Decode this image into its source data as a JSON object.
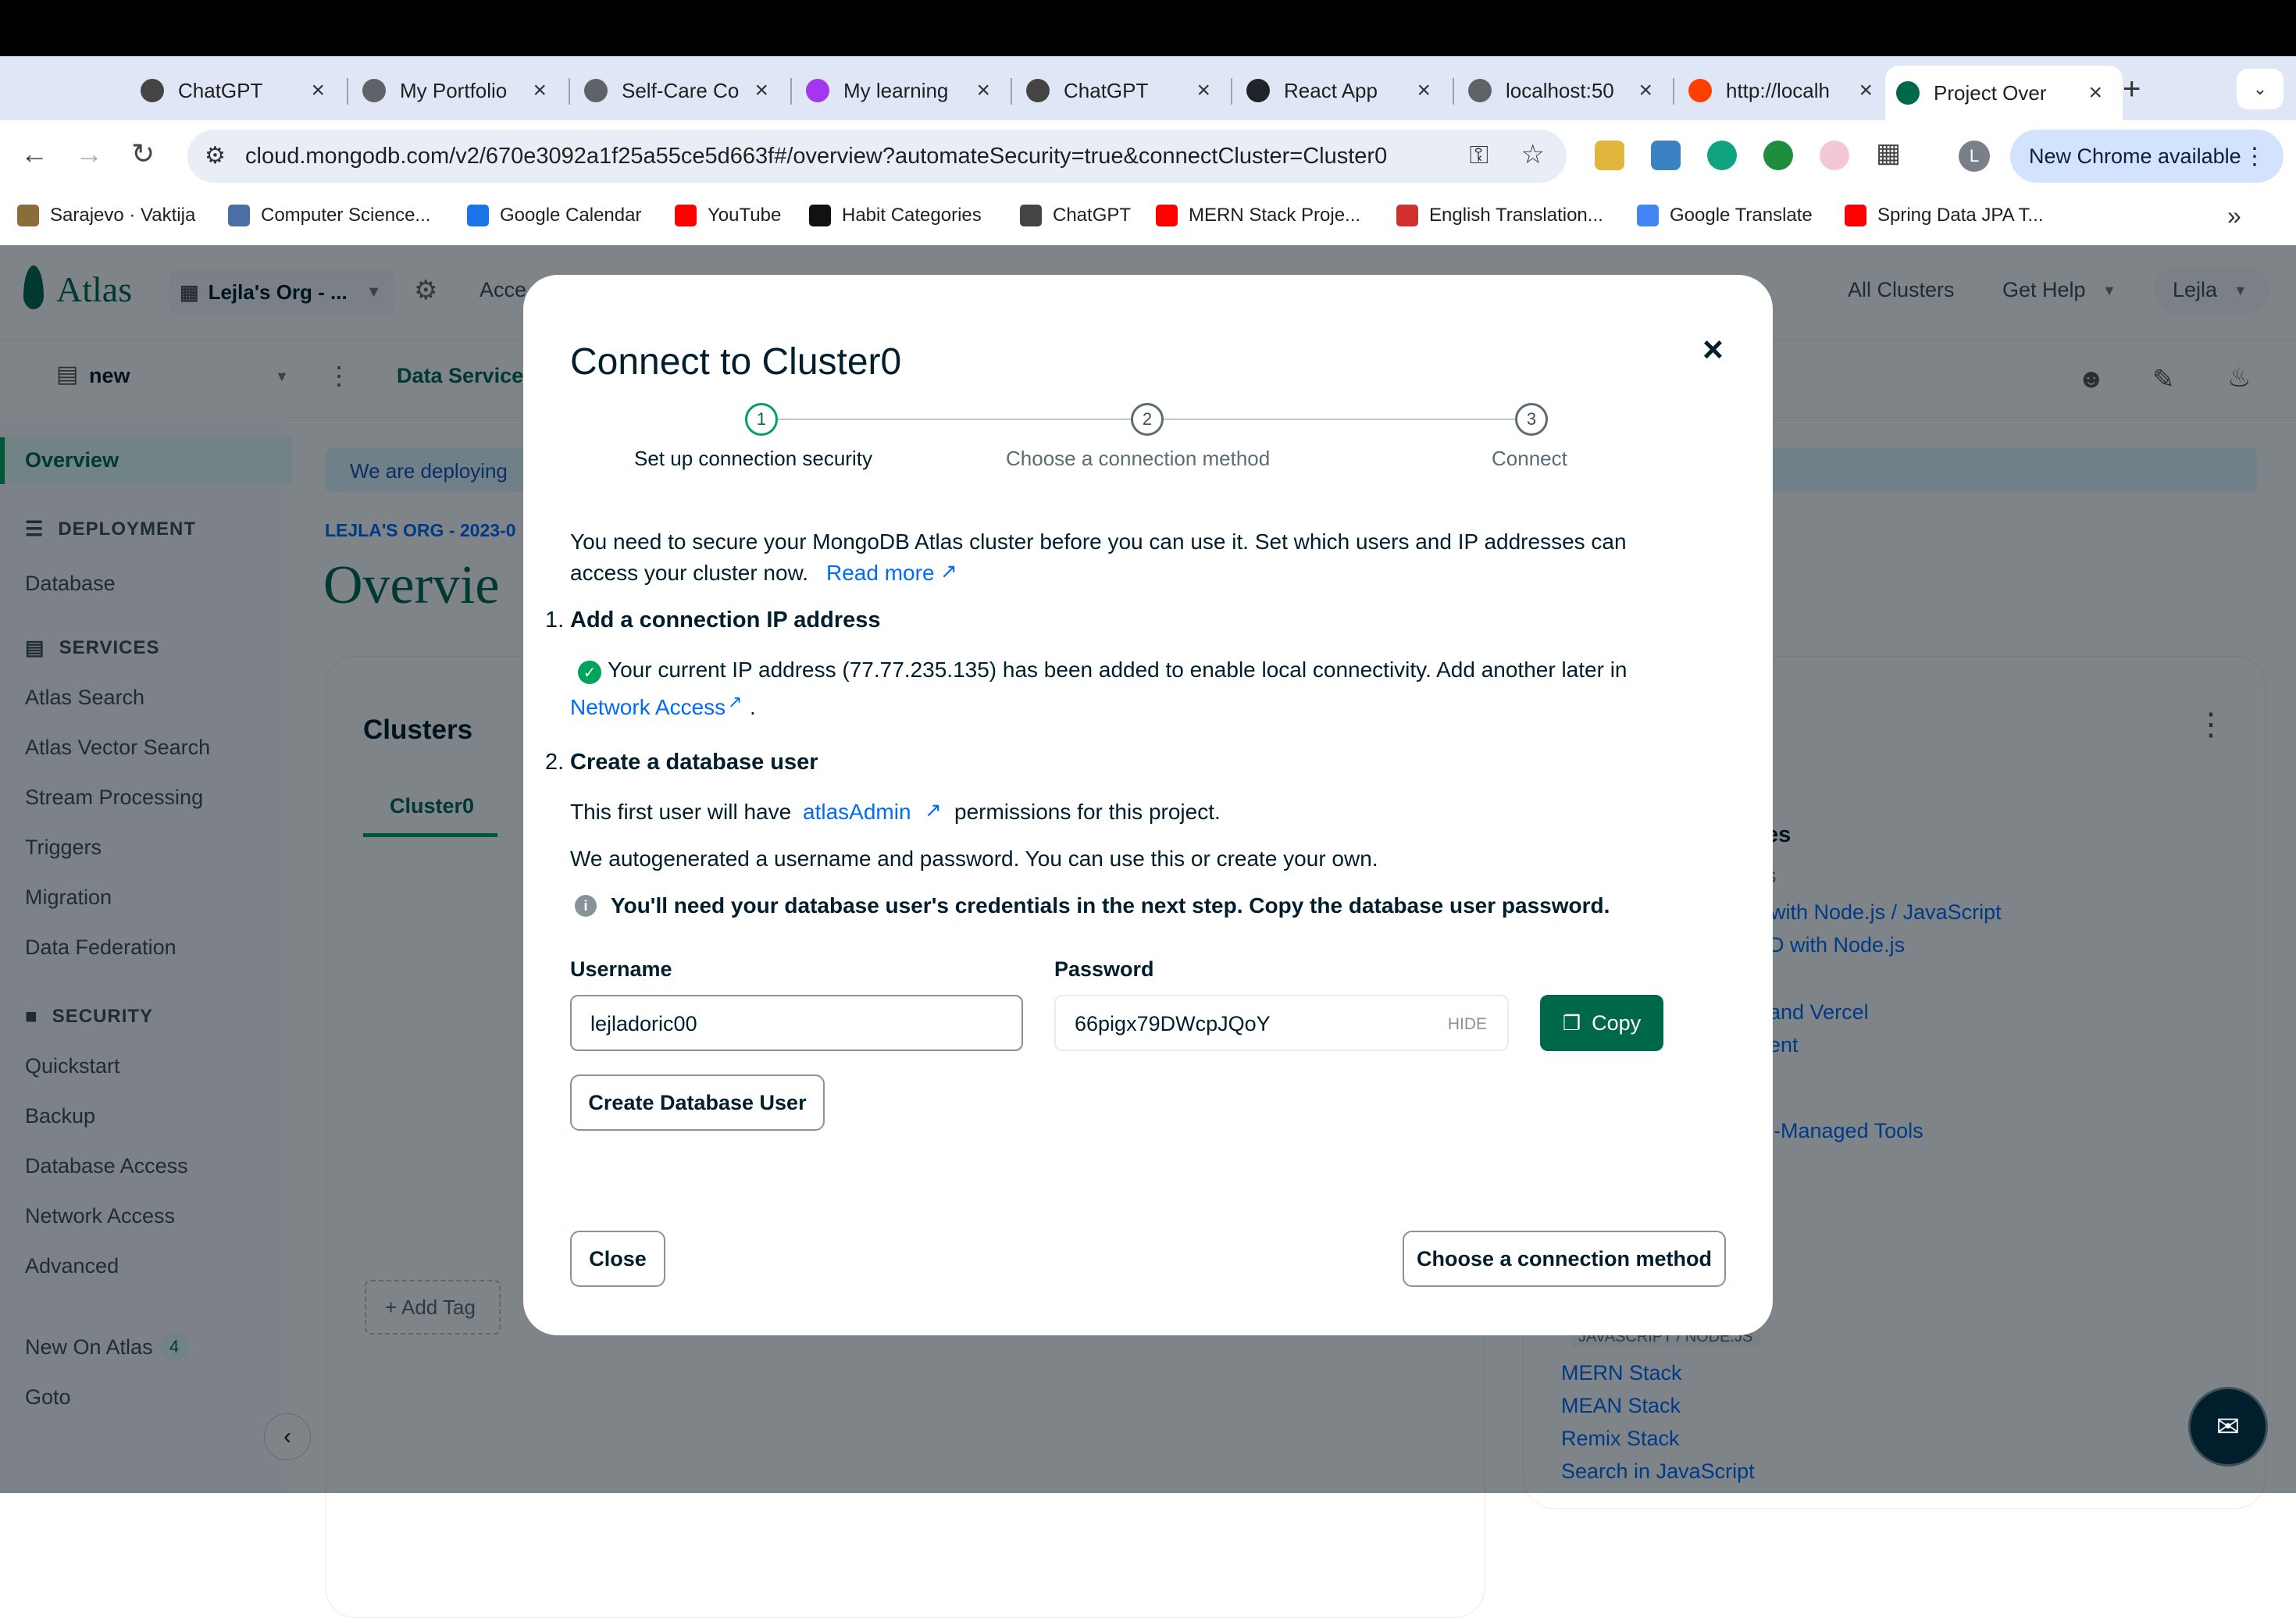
{
  "browser": {
    "tabs": [
      {
        "title": "ChatGPT",
        "icon": "chatgpt-icon",
        "color": "#444444"
      },
      {
        "title": "My Portfolio",
        "icon": "globe-icon",
        "color": "#5f6368"
      },
      {
        "title": "Self-Care Co",
        "icon": "globe-icon",
        "color": "#5f6368"
      },
      {
        "title": "My learning",
        "icon": "learning-icon",
        "color": "#a435f0"
      },
      {
        "title": "ChatGPT",
        "icon": "chatgpt-icon",
        "color": "#444444"
      },
      {
        "title": "React App",
        "icon": "react-icon",
        "color": "#20232a"
      },
      {
        "title": "localhost:50",
        "icon": "globe-icon",
        "color": "#5f6368"
      },
      {
        "title": "http://localh",
        "icon": "svelte-icon",
        "color": "#ff3e00"
      },
      {
        "title": "Project Over",
        "icon": "mongodb-leaf-icon",
        "color": "#00684a",
        "active": true
      }
    ],
    "new_tab": "+",
    "url": "cloud.mongodb.com/v2/670e3092a1f25a55ce5d663f#/overview?automateSecurity=true&connectCluster=Cluster0",
    "profile_initial": "L",
    "new_chrome_label": "New Chrome available",
    "bookmarks": [
      {
        "label": "Sarajevo · Vaktija",
        "icon": "clock-icon",
        "color": "#8a6d3b"
      },
      {
        "label": "Computer Science...",
        "icon": "university-icon",
        "color": "#4a6fa5"
      },
      {
        "label": "Google Calendar",
        "icon": "calendar-icon",
        "color": "#1a73e8"
      },
      {
        "label": "YouTube",
        "icon": "youtube-icon",
        "color": "#ff0000"
      },
      {
        "label": "Habit Categories",
        "icon": "aip-icon",
        "color": "#111111"
      },
      {
        "label": "ChatGPT",
        "icon": "chatgpt-icon",
        "color": "#444444"
      },
      {
        "label": "MERN Stack Proje...",
        "icon": "youtube-icon",
        "color": "#ff0000"
      },
      {
        "label": "English Translation...",
        "icon": "c-icon",
        "color": "#d32f2f"
      },
      {
        "label": "Google Translate",
        "icon": "translate-icon",
        "color": "#4285f4"
      },
      {
        "label": "Spring Data JPA T...",
        "icon": "youtube-icon",
        "color": "#ff0000"
      }
    ],
    "bookmarks_more": "»"
  },
  "atlas": {
    "logo_text": "Atlas",
    "org_name": "Lejla's Org - ...",
    "access_partial": "Acce",
    "all_clusters": "All Clusters",
    "get_help": "Get Help",
    "user": "Lejla",
    "project": "new",
    "data_services_tab": "Data Service",
    "banner_partial": "We are deploying",
    "breadcrumb_partial": "LEJLA'S ORG - 2023-0",
    "page_title_partial": "Overvie",
    "clusters_heading": "Clusters",
    "cluster_tab": "Cluster0",
    "add_tag": "+ Add Tag",
    "right_panel": {
      "heading_partial": "es",
      "tag_partial": "JS",
      "links_partial": [
        "with Node.js / JavaScript",
        "D with Node.js",
        "",
        "and Vercel",
        "ent",
        "-Managed Tools"
      ],
      "tag2": "JAVASCRIPT / NODE.JS",
      "links": [
        "MERN Stack",
        "MEAN Stack",
        "Remix Stack",
        "Search in JavaScript"
      ]
    },
    "sidebar": {
      "overview": "Overview",
      "deployment_head": "DEPLOYMENT",
      "database": "Database",
      "services_head": "SERVICES",
      "services": [
        "Atlas Search",
        "Atlas Vector Search",
        "Stream Processing",
        "Triggers",
        "Migration",
        "Data Federation"
      ],
      "security_head": "SECURITY",
      "security": [
        "Quickstart",
        "Backup",
        "Database Access",
        "Network Access",
        "Advanced"
      ],
      "new_on_atlas": "New On Atlas",
      "new_on_atlas_count": "4",
      "goto": "Goto"
    }
  },
  "modal": {
    "title": "Connect to Cluster0",
    "close_x": "×",
    "steps": [
      {
        "number": "1",
        "label": "Set up connection security",
        "state": "active"
      },
      {
        "number": "2",
        "label": "Choose a connection method",
        "state": "pending"
      },
      {
        "number": "3",
        "label": "Connect",
        "state": "pending"
      }
    ],
    "intro_line1": "You need to secure your MongoDB Atlas cluster before you can use it. Set which users and IP addresses can",
    "intro_line2": "access your cluster now.",
    "read_more": "Read more",
    "section1_number": "1.",
    "section1_title": "Add a connection IP address",
    "ip_line1": "Your current IP address (77.77.235.135) has been added to enable local connectivity. Add another later in",
    "network_access_link": "Network Access",
    "ip_period": ".",
    "section2_number": "2.",
    "section2_title": "Create a database user",
    "user_line_prefix": "This first user will have",
    "atlas_admin_link": "atlasAdmin",
    "user_line_suffix": "permissions for this project.",
    "autogen_line": "We autogenerated a username and password. You can use this or create your own.",
    "info_line": "You'll need your database user's credentials in the next step. Copy the database user password.",
    "username_label": "Username",
    "username_value": "lejladoric00",
    "password_label": "Password",
    "password_value": "66pigx79DWcpJQoY",
    "hide_label": "HIDE",
    "copy_label": "Copy",
    "create_user_label": "Create Database User",
    "close_label": "Close",
    "next_label": "Choose a connection method"
  },
  "colors": {
    "atlas_green": "#00684a",
    "link_blue": "#016bf8",
    "success_green": "#00a35c",
    "copy_button": "#00684a"
  }
}
